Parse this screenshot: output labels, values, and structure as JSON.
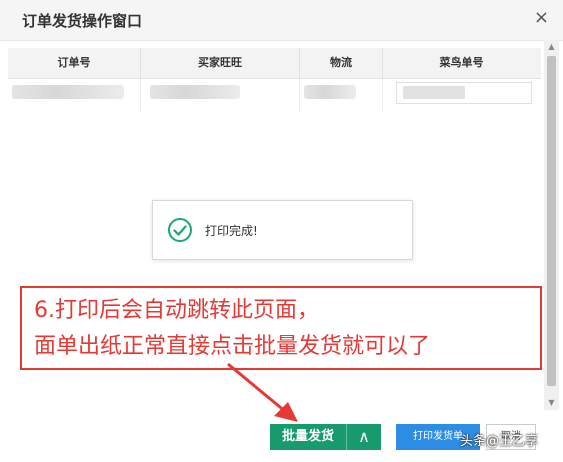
{
  "window": {
    "title": "订单发货操作窗口",
    "close_glyph": "×"
  },
  "table": {
    "columns": [
      "订单号",
      "买家旺旺",
      "物流",
      "菜鸟单号"
    ]
  },
  "scrollbar": {
    "up_glyph": "▲",
    "down_glyph": "▼"
  },
  "toast": {
    "icon": "check-circle-icon",
    "message": "打印完成!"
  },
  "annotation": {
    "line1": "6.打印后会自动跳转此页面，",
    "line2": "面单出纸正常直接点击批量发货就可以了",
    "color": "#e53935"
  },
  "buttons": {
    "batch_ship": "批量发货",
    "batch_ship_dropdown_glyph": "∧",
    "print_label": "打印发货单",
    "cancel": "取消"
  },
  "watermark": "头条@王乙享",
  "colors": {
    "batch_ship": "#179a6e",
    "print": "#2d8ce3",
    "success": "#1aa57a"
  }
}
